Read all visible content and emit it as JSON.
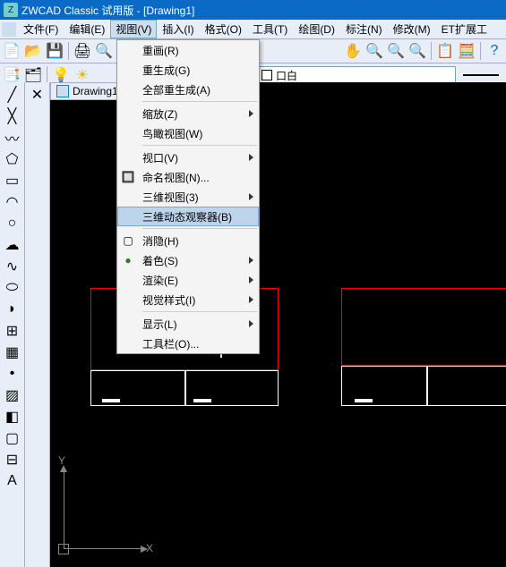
{
  "title": "ZWCAD Classic 试用版 - [Drawing1]",
  "menubar": [
    {
      "label": "文件(F)"
    },
    {
      "label": "编辑(E)"
    },
    {
      "label": "视图(V)",
      "open": true
    },
    {
      "label": "插入(I)"
    },
    {
      "label": "格式(O)"
    },
    {
      "label": "工具(T)"
    },
    {
      "label": "绘图(D)"
    },
    {
      "label": "标注(N)"
    },
    {
      "label": "修改(M)"
    },
    {
      "label": "ET扩展工"
    }
  ],
  "dropdown": {
    "items": [
      {
        "label": "重画(R)"
      },
      {
        "label": "重生成(G)"
      },
      {
        "label": "全部重生成(A)"
      },
      {
        "sep": true
      },
      {
        "label": "缩放(Z)",
        "sub": true
      },
      {
        "label": "鸟瞰视图(W)"
      },
      {
        "sep": true
      },
      {
        "label": "视口(V)",
        "sub": true
      },
      {
        "label": "命名视图(N)...",
        "icon": "named-view-icon",
        "icon_glyph": "🔲"
      },
      {
        "label": "三维视图(3)",
        "sub": true
      },
      {
        "label": "三维动态观察器(B)",
        "highlight": true
      },
      {
        "sep": true
      },
      {
        "label": "消隐(H)",
        "icon": "hide-icon",
        "icon_glyph": "▢"
      },
      {
        "label": "着色(S)",
        "sub": true,
        "icon": "shade-icon",
        "icon_glyph": "●",
        "icon_color": "#2a7e2a"
      },
      {
        "label": "渲染(E)",
        "sub": true
      },
      {
        "label": "视觉样式(I)",
        "sub": true
      },
      {
        "sep": true
      },
      {
        "label": "显示(L)",
        "sub": true
      },
      {
        "label": "工具栏(O)..."
      }
    ]
  },
  "layer": {
    "swatch": "#ffffff",
    "name": "口白"
  },
  "doc_tab": "Drawing1",
  "ucs": {
    "x": "X",
    "y": "Y"
  },
  "icons": {
    "logo": "Z"
  }
}
